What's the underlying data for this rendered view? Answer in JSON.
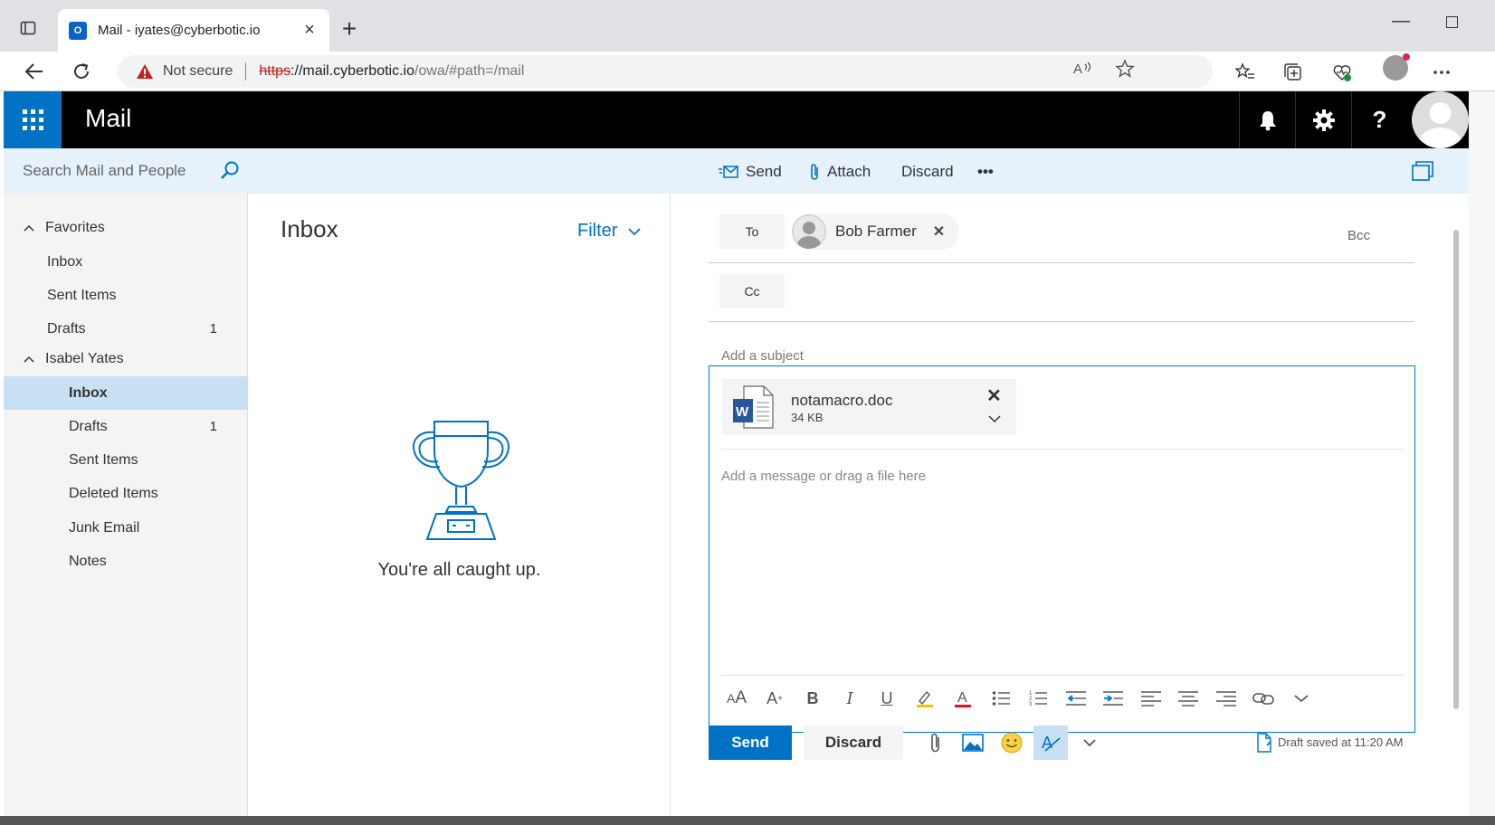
{
  "browser": {
    "tab_title": "Mail - iyates@cyberbotic.io",
    "favicon_text": "O",
    "new_tab": "+",
    "security_label": "Not secure",
    "url_scheme": "https",
    "url_host": "://mail.cyberbotic.io",
    "url_path": "/owa/#path=/mail"
  },
  "app": {
    "title": "Mail"
  },
  "search": {
    "placeholder": "Search Mail and People"
  },
  "nav": {
    "favorites_label": "Favorites",
    "favorites": [
      {
        "label": "Inbox",
        "count": ""
      },
      {
        "label": "Sent Items",
        "count": ""
      },
      {
        "label": "Drafts",
        "count": "1"
      }
    ],
    "account_label": "Isabel Yates",
    "folders": [
      {
        "label": "Inbox",
        "count": "",
        "selected": true
      },
      {
        "label": "Drafts",
        "count": "1"
      },
      {
        "label": "Sent Items",
        "count": ""
      },
      {
        "label": "Deleted Items",
        "count": ""
      },
      {
        "label": "Junk Email",
        "count": ""
      },
      {
        "label": "Notes",
        "count": ""
      }
    ]
  },
  "list": {
    "title": "Inbox",
    "filter_label": "Filter",
    "empty_message": "You're all caught up."
  },
  "commands": {
    "send": "Send",
    "attach": "Attach",
    "discard": "Discard",
    "more": "•••"
  },
  "compose": {
    "to_label": "To",
    "cc_label": "Cc",
    "bcc_label": "Bcc",
    "recipient": "Bob Farmer",
    "subject_placeholder": "Add a subject",
    "body_placeholder": "Add a message or drag a file here",
    "attachment": {
      "name": "notamacro.doc",
      "size": "34 KB",
      "icon": "word-doc-icon"
    },
    "send_button": "Send",
    "discard_button": "Discard",
    "draft_status": "Draft saved at 11:20 AM"
  },
  "colors": {
    "accent": "#0072c6",
    "header": "#000000",
    "band": "#e5f1fb",
    "selected": "#c7e0f4",
    "warning": "#c5221f"
  }
}
